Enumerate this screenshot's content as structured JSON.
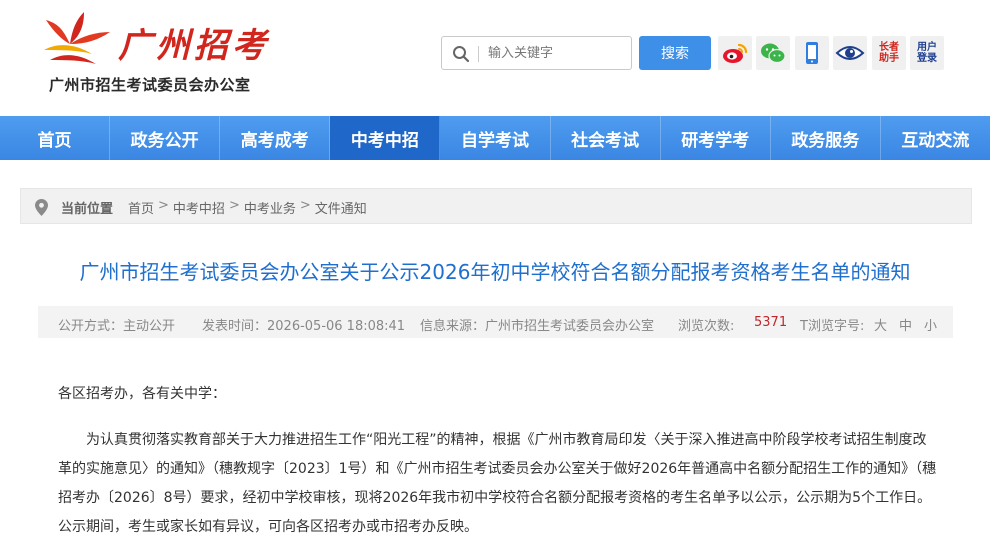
{
  "header": {
    "logo_title": "广州招考",
    "logo_subtitle": "广州市招生考试委员会办公室",
    "search": {
      "placeholder": "输入关键字",
      "value": "",
      "button_label": "搜索"
    },
    "tools": [
      {
        "icon": "weibo-icon"
      },
      {
        "icon": "wechat-icon"
      },
      {
        "icon": "mobile-icon"
      },
      {
        "icon": "eye-icon"
      },
      {
        "icon": "elder-assist-icon",
        "line1": "长者",
        "line2": "助手"
      },
      {
        "icon": "user-login-icon",
        "line1": "用户",
        "line2": "登录"
      }
    ]
  },
  "nav": {
    "items": [
      "首页",
      "政务公开",
      "高考成考",
      "中考中招",
      "自学考试",
      "社会考试",
      "研考学考",
      "政务服务",
      "互动交流"
    ],
    "active_index": 3
  },
  "breadcrumb": {
    "label": "当前位置",
    "items": [
      "首页",
      "中考中招",
      "中考业务",
      "文件通知"
    ],
    "separator": ">"
  },
  "article": {
    "title": "广州市招生考试委员会办公室关于公示2026年初中学校符合名额分配报考资格考生名单的通知",
    "meta": {
      "disclosure": "公开方式：主动公开",
      "publish_time": "发表时间：2026-05-06 18:08:41",
      "source": "信息来源：广州市招生考试委员会办公室",
      "views_label": "浏览次数:",
      "views_count": "5371",
      "font_size_label": "T浏览字号:",
      "font_sizes": [
        "大",
        "中",
        "小"
      ]
    },
    "greeting": "各区招考办，各有关中学：",
    "paragraph": "为认真贯彻落实教育部关于大力推进招生工作“阳光工程”的精神，根据《广州市教育局印发〈关于深入推进高中阶段学校考试招生制度改革的实施意见〉的通知》（穗教规字〔2023〕1号）和《广州市招生考试委员会办公室关于做好2026年普通高中名额分配招生工作的通知》（穗招考办〔2026〕8号）要求，经初中学校审核，现将2026年我市初中学校符合名额分配报考资格的考生名单予以公示，公示期为5个工作日。公示期间，考生或家长如有异议，可向各区招考办或市招考办反映。"
  },
  "colors": {
    "brand_red": "#d0261d",
    "nav_blue": "#3a86e3",
    "nav_active": "#1f67c8",
    "title_blue": "#1f6fcf",
    "views_red": "#c0272d"
  }
}
